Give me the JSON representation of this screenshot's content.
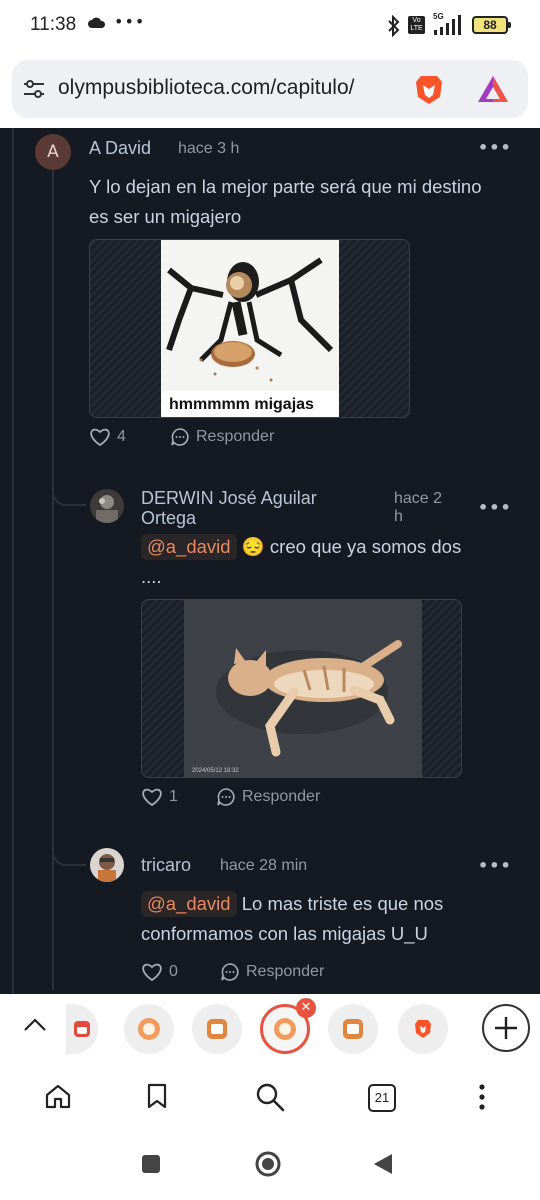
{
  "status_bar": {
    "time": "11:38",
    "network": "5G",
    "volte": "Vo LTE",
    "battery": "88"
  },
  "url_bar": {
    "url": "olympusbiblioteca.com/capitulo/"
  },
  "comments": [
    {
      "author": "A David",
      "avatar_letter": "A",
      "time": "hace 3 h",
      "text": "Y lo dejan en la mejor parte será que mi destino es ser un migajero",
      "image_caption": "hmmmmm migajas",
      "likes": "4",
      "reply_label": "Responder"
    },
    {
      "author_line1": "DERWIN José Aguilar",
      "author_line2": "Ortega",
      "time_line1": "hace 2",
      "time_line2": "h",
      "mention": "@a_david",
      "emoji": "😔",
      "text_part": "creo que ya somos dos",
      "text_line2": "....",
      "photo_timestamp": "2024/05/12 18:32",
      "likes": "1",
      "reply_label": "Responder"
    },
    {
      "author": "tricaro",
      "time": "hace 28 min",
      "mention": "@a_david",
      "text_part": "Lo mas triste es que nos",
      "text_line2": "conformamos con las migajas U_U",
      "likes": "0",
      "reply_label": "Responder"
    }
  ],
  "tab_strip": {
    "tab_count": "21"
  },
  "icons": [
    "cloud-icon",
    "bluetooth-icon",
    "signal-icon",
    "tune-icon",
    "brave-lion-icon",
    "brave-rewards-icon",
    "heart-icon",
    "comment-icon",
    "chevron-up-icon",
    "plus-icon",
    "close-icon",
    "home-icon",
    "bookmark-icon",
    "search-icon",
    "kebab-menu-icon",
    "square-icon",
    "circle-icon",
    "back-triangle-icon"
  ],
  "colors": {
    "page_bg": "#151a22",
    "text": "#c9d3e2",
    "mention": "#e98a5c",
    "brave_orange": "#fb542b"
  }
}
